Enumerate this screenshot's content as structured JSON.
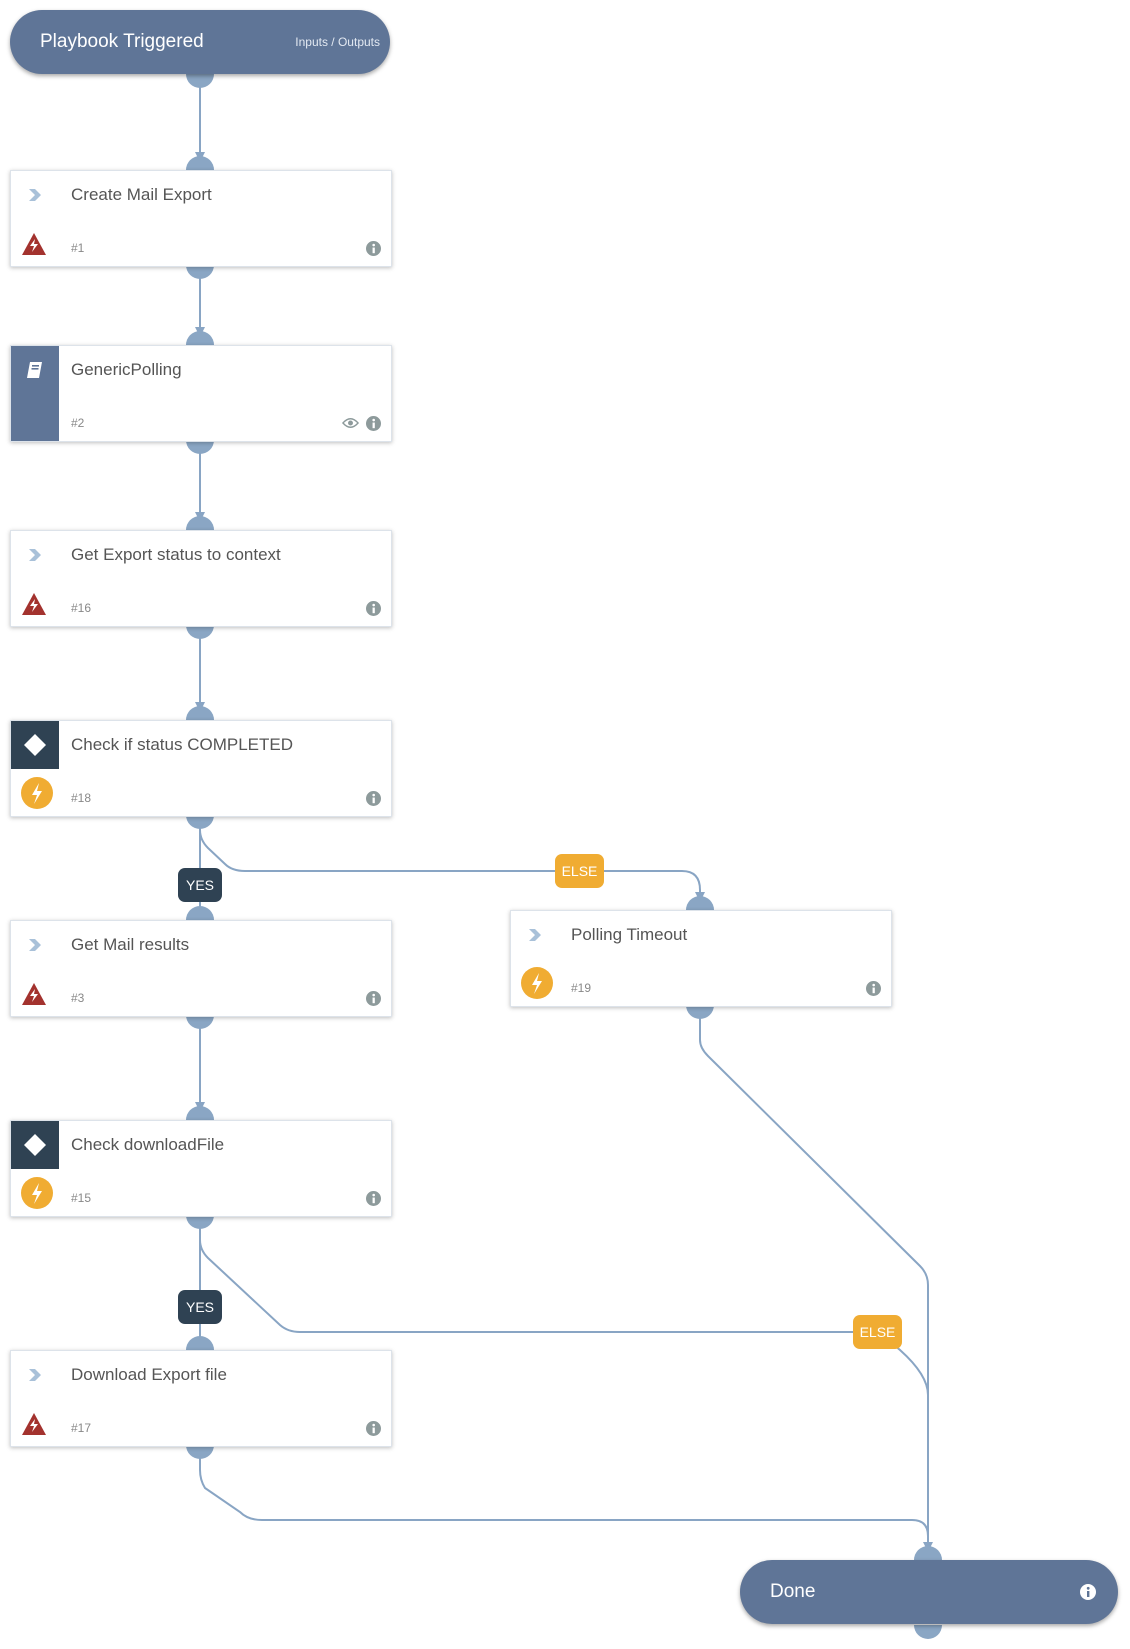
{
  "trigger": {
    "title": "Playbook Triggered",
    "io_link": "Inputs / Outputs"
  },
  "tasks": [
    {
      "id": "create-mail-export",
      "name": "Create Mail Export",
      "number": "#1",
      "type": "command",
      "status": "error",
      "has_eye": false
    },
    {
      "id": "generic-polling",
      "name": "GenericPolling",
      "number": "#2",
      "type": "subplaybook",
      "status": "none",
      "has_eye": true
    },
    {
      "id": "get-export-status",
      "name": "Get Export status to context",
      "number": "#16",
      "type": "command",
      "status": "error",
      "has_eye": false
    },
    {
      "id": "check-status-completed",
      "name": "Check if status COMPLETED",
      "number": "#18",
      "type": "condition",
      "status": "manual",
      "has_eye": false
    },
    {
      "id": "get-mail-results",
      "name": "Get Mail results",
      "number": "#3",
      "type": "command",
      "status": "error",
      "has_eye": false
    },
    {
      "id": "polling-timeout",
      "name": "Polling Timeout",
      "number": "#19",
      "type": "command",
      "status": "manual",
      "has_eye": false
    },
    {
      "id": "check-download-file",
      "name": "Check downloadFile",
      "number": "#15",
      "type": "condition",
      "status": "manual",
      "has_eye": false
    },
    {
      "id": "download-export-file",
      "name": "Download Export file",
      "number": "#17",
      "type": "command",
      "status": "error",
      "has_eye": false
    }
  ],
  "branch_labels": {
    "yes_1": "YES",
    "else_1": "ELSE",
    "yes_2": "YES",
    "else_2": "ELSE"
  },
  "done": {
    "title": "Done"
  },
  "colors": {
    "node_header": "#5f7597",
    "edge": "#89a5c4",
    "condition": "#2f4253",
    "else_badge": "#f0ac32",
    "error_icon": "#a3322e",
    "manual_icon": "#f0ac32"
  }
}
